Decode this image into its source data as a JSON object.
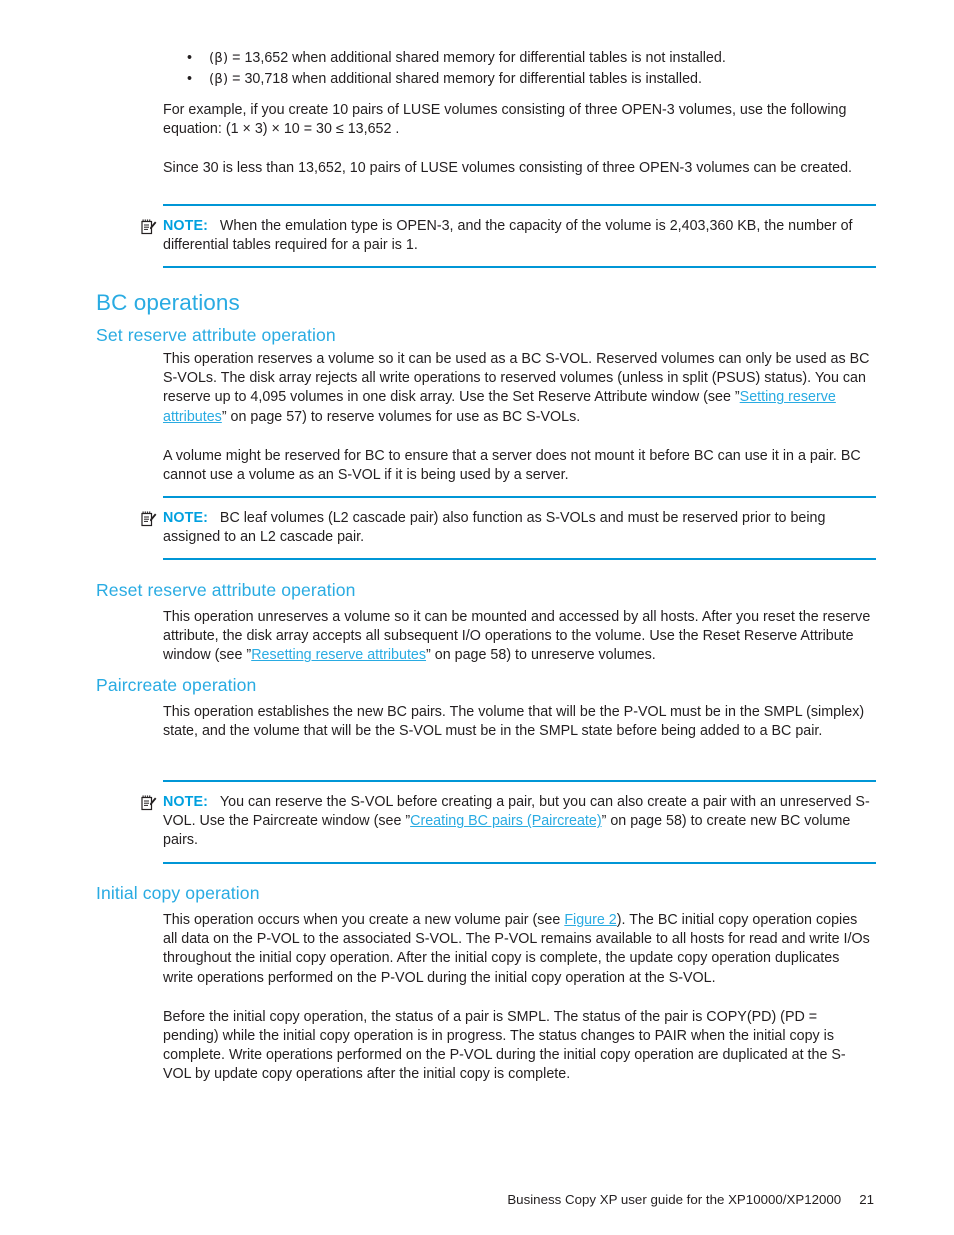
{
  "colors": {
    "heading": "#29abe2",
    "link": "#29abe2",
    "note_rule": "#0096d6",
    "note_label": "#00a0df",
    "body_text": "#231f20"
  },
  "bullets": [
    {
      "symbol": "•",
      "greek": "(β)",
      "text": " = 13,652 when additional shared memory for differential tables is not installed."
    },
    {
      "symbol": "•",
      "greek": "(β)",
      "text": " = 30,718 when additional shared memory for differential tables is installed."
    }
  ],
  "paragraphs": {
    "example_intro": "For example, if you create 10 pairs of LUSE volumes consisting of three OPEN-3 volumes, use the following equation: ",
    "equation": "(1 × 3) × 10  =  30 ≤ 13,652 .",
    "since": "Since 30 is less than 13,652, 10 pairs of LUSE volumes consisting of three OPEN-3 volumes can be created."
  },
  "notes": {
    "note1": {
      "icon": "note-pencil-icon",
      "label": "NOTE:",
      "text": "When the emulation type is OPEN-3, and the capacity of the volume is 2,403,360 KB, the number of differential tables required for a pair is 1."
    },
    "note2": {
      "icon": "note-pencil-icon",
      "label": "NOTE:",
      "text": "BC leaf volumes (L2 cascade pair) also function as S-VOLs and must be reserved prior to being assigned to an L2 cascade pair."
    },
    "note3": {
      "icon": "note-pencil-icon",
      "label": "NOTE:",
      "text_before_link": "You can reserve the S-VOL before creating a pair, but you can also create a pair with an unreserved S-VOL. Use the Paircreate window (see ”",
      "link": "Creating BC pairs (Paircreate)",
      "text_after_link": "” on page 58) to create new BC volume pairs."
    }
  },
  "sections": {
    "bc_operations": {
      "title": "BC operations"
    },
    "set_reserve": {
      "title": "Set reserve attribute operation",
      "para1_before_link": "This operation reserves a volume so it can be used as a BC S-VOL. Reserved volumes can only be used as BC S-VOLs. The disk array rejects all write operations to reserved volumes (unless in split (PSUS) status). You can reserve up to 4,095 volumes in one disk array. Use the Set Reserve Attribute window (see ”",
      "para1_link": "Setting reserve attributes",
      "para1_after_link": "” on page 57) to reserve volumes for use as BC S-VOLs.",
      "para2": "A volume might be reserved for BC to ensure that a server does not mount it before BC can use it in a pair. BC cannot use a volume as an S-VOL if it is being used by a server."
    },
    "reset_reserve": {
      "title": "Reset reserve attribute operation",
      "para1_before_link": "This operation unreserves a volume so it can be mounted and accessed by all hosts. After you reset the reserve attribute, the disk array accepts all subsequent I/O operations to the volume. Use the Reset Reserve Attribute window (see ”",
      "para1_link": "Resetting reserve attributes",
      "para1_after_link": "” on page 58) to unreserve volumes."
    },
    "paircreate": {
      "title": "Paircreate operation",
      "para1": "This operation establishes the new BC pairs. The volume that will be the P-VOL must be in the SMPL (simplex) state, and the volume that will be the S-VOL must be in the SMPL state before being added to a BC pair."
    },
    "initial_copy": {
      "title": "Initial copy operation",
      "para1_before_link": "This operation occurs when you create a new volume pair (see ",
      "para1_link": "Figure 2",
      "para1_after_link": "). The BC initial copy operation copies all data on the P-VOL to the associated S-VOL. The P-VOL remains available to all hosts for read and write I/Os throughout the initial copy operation. After the initial copy is complete, the update copy operation duplicates write operations performed on the P-VOL during the initial copy operation at the S-VOL.",
      "para2": "Before the initial copy operation, the status of a pair is SMPL. The status of the pair is COPY(PD) (PD = pending) while the initial copy operation is in progress. The status changes to PAIR when the initial copy is complete. Write operations performed on the P-VOL during the initial copy operation are duplicated at the S-VOL by update copy operations after the initial copy is complete."
    }
  },
  "footer": {
    "guide_title": "Business Copy XP user guide for the XP10000/XP12000",
    "page_number": "21"
  }
}
